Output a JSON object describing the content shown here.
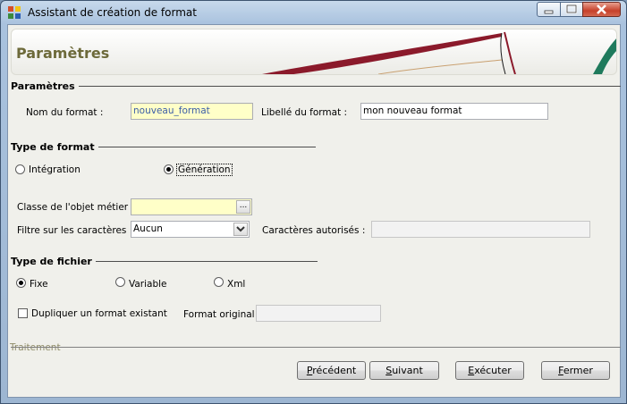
{
  "window": {
    "title": "Assistant de création de format",
    "controls": {
      "minimize": "minimize-icon",
      "maximize": "maximize-icon",
      "close": "close-icon"
    }
  },
  "banner": {
    "title": "Paramètres"
  },
  "parametres": {
    "group_label": "Paramètres",
    "nom_label": "Nom du format :",
    "nom_value": "nouveau_format",
    "libelle_label": "Libellé du format :",
    "libelle_value": "mon nouveau format"
  },
  "type_format": {
    "group_label": "Type de format",
    "integration_label": "Intégration",
    "generation_label": "Génération",
    "selected": "Génération"
  },
  "classe": {
    "label": "Classe de l'objet métier :",
    "value": "",
    "button": "..."
  },
  "filtre": {
    "label": "Filtre sur les caractères :",
    "value": "Aucun"
  },
  "caracteres": {
    "label": "Caractères autorisés :",
    "value": ""
  },
  "type_fichier": {
    "group_label": "Type de fichier",
    "fixe_label": "Fixe",
    "variable_label": "Variable",
    "xml_label": "Xml",
    "selected": "Fixe"
  },
  "dupliquer": {
    "label": "Dupliquer un format existant",
    "checked": false
  },
  "format_original": {
    "label": "Format original :",
    "value": ""
  },
  "traitement": {
    "label": "Traitement"
  },
  "buttons": {
    "precedent_first": "P",
    "precedent_rest": "récédent",
    "suivant_first": "S",
    "suivant_rest": "uivant",
    "executer_first": "E",
    "executer_rest": "xécuter",
    "fermer_first": "F",
    "fermer_rest": "ermer"
  },
  "colors": {
    "accent_brand": "#8b1a2b",
    "banner_title": "#6d6a3a",
    "required_field": "#ffffc8"
  }
}
